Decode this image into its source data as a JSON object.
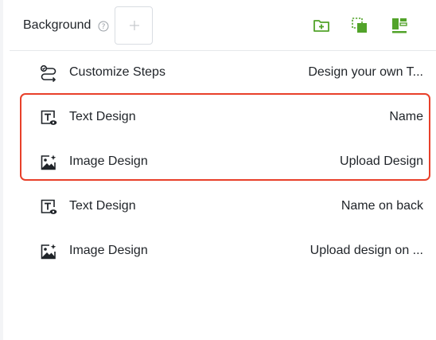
{
  "header": {
    "background_label": "Background",
    "help_icon": "question-circle-icon",
    "upload_icon": "plus-icon",
    "tools": [
      {
        "name": "add-folder-button",
        "icon": "folder-plus-icon"
      },
      {
        "name": "copy-layer-button",
        "icon": "layers-copy-icon"
      },
      {
        "name": "layout-button",
        "icon": "layout-icon"
      }
    ],
    "accent_color": "#52a32a"
  },
  "rows": [
    {
      "icon": "steps-icon",
      "name": "Customize Steps",
      "value": "Design your own T..."
    },
    {
      "icon": "text-design-icon",
      "name": "Text Design",
      "value": "Name"
    },
    {
      "icon": "image-design-icon",
      "name": "Image Design",
      "value": "Upload Design"
    },
    {
      "icon": "text-design-icon",
      "name": "Text Design",
      "value": "Name on back"
    },
    {
      "icon": "image-design-icon",
      "name": "Image Design",
      "value": "Upload design on ..."
    }
  ],
  "highlight_color": "#e8402a"
}
